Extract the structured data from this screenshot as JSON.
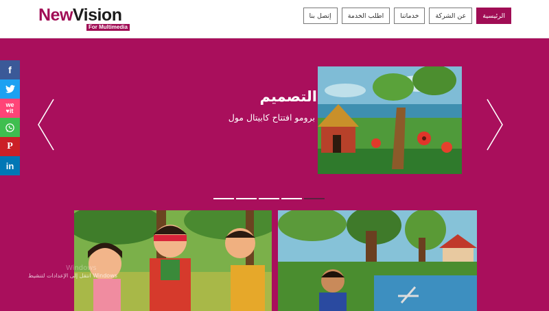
{
  "header": {
    "logo": {
      "main_new": "New",
      "main_vision": "Vision",
      "sub": "For Multimedia"
    },
    "nav": [
      {
        "label": "الرئيسية",
        "active": true
      },
      {
        "label": "عن الشركة",
        "active": false
      },
      {
        "label": "خدماتنا",
        "active": false
      },
      {
        "label": "اطلب الخدمة",
        "active": false
      },
      {
        "label": "إتصل بنا",
        "active": false
      }
    ]
  },
  "share": [
    {
      "name": "facebook",
      "glyph": "f",
      "color": "#3b5998"
    },
    {
      "name": "twitter",
      "glyph": "t",
      "color": "#1da1f2"
    },
    {
      "name": "weheartit",
      "glyph": "we♥",
      "color": "#ff4477"
    },
    {
      "name": "whatsapp",
      "glyph": "✆",
      "color": "#3fbe4f"
    },
    {
      "name": "pinterest",
      "glyph": "P",
      "color": "#cb2027"
    },
    {
      "name": "linkedin",
      "glyph": "in",
      "color": "#0077b5"
    }
  ],
  "slider": {
    "title": "التصميم",
    "subtitle": "برومو افتتاح كابيتال مول",
    "dots": 5,
    "active_dot": 4
  },
  "watermark": {
    "en": "Windows",
    "ar": "Windows انتقل إلى الإعدادات لتنشيط"
  },
  "colors": {
    "brand": "#a00d55",
    "background": "#a90f5c"
  }
}
